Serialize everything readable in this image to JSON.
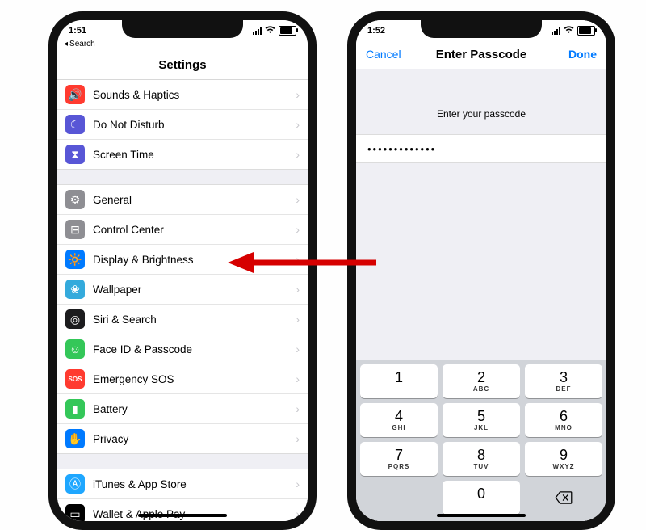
{
  "leftPhone": {
    "statusbar": {
      "time": "1:51",
      "locationArrow": "↗",
      "backLabel": "Search"
    },
    "navbar": {
      "title": "Settings"
    },
    "groups": [
      {
        "rows": [
          {
            "id": "sounds",
            "label": "Sounds & Haptics",
            "iconBg": "#ff3b30",
            "glyph": "🔊"
          },
          {
            "id": "dnd",
            "label": "Do Not Disturb",
            "iconBg": "#5856d6",
            "glyph": "☾"
          },
          {
            "id": "screentime",
            "label": "Screen Time",
            "iconBg": "#5856d6",
            "glyph": "⧗"
          }
        ]
      },
      {
        "rows": [
          {
            "id": "general",
            "label": "General",
            "iconBg": "#8e8e93",
            "glyph": "⚙"
          },
          {
            "id": "controlcenter",
            "label": "Control Center",
            "iconBg": "#8e8e93",
            "glyph": "⊟"
          },
          {
            "id": "display",
            "label": "Display & Brightness",
            "iconBg": "#007aff",
            "glyph": "🔆"
          },
          {
            "id": "wallpaper",
            "label": "Wallpaper",
            "iconBg": "#34aadc",
            "glyph": "❀"
          },
          {
            "id": "siri",
            "label": "Siri & Search",
            "iconBg": "#1c1c1e",
            "glyph": "◎"
          },
          {
            "id": "faceid",
            "label": "Face ID & Passcode",
            "iconBg": "#34c759",
            "glyph": "☺"
          },
          {
            "id": "sos",
            "label": "Emergency SOS",
            "iconBg": "#ff3b30",
            "glyph": "SOS",
            "small": true
          },
          {
            "id": "battery",
            "label": "Battery",
            "iconBg": "#34c759",
            "glyph": "▮"
          },
          {
            "id": "privacy",
            "label": "Privacy",
            "iconBg": "#007aff",
            "glyph": "✋"
          }
        ]
      },
      {
        "rows": [
          {
            "id": "itunes",
            "label": "iTunes & App Store",
            "iconBg": "#1fa7ff",
            "glyph": "Ⓐ"
          },
          {
            "id": "wallet",
            "label": "Wallet & Apple Pay",
            "iconBg": "#000000",
            "glyph": "▭"
          }
        ]
      }
    ]
  },
  "rightPhone": {
    "statusbar": {
      "time": "1:52",
      "locationArrow": "↗"
    },
    "navbar": {
      "cancel": "Cancel",
      "title": "Enter Passcode",
      "done": "Done"
    },
    "prompt": "Enter your passcode",
    "passcodeMasked": "•••••••••••••",
    "keypad": [
      {
        "num": "1",
        "letters": ""
      },
      {
        "num": "2",
        "letters": "ABC"
      },
      {
        "num": "3",
        "letters": "DEF"
      },
      {
        "num": "4",
        "letters": "GHI"
      },
      {
        "num": "5",
        "letters": "JKL"
      },
      {
        "num": "6",
        "letters": "MNO"
      },
      {
        "num": "7",
        "letters": "PQRS"
      },
      {
        "num": "8",
        "letters": "TUV"
      },
      {
        "num": "9",
        "letters": "WXYZ"
      },
      {
        "blank": true
      },
      {
        "num": "0",
        "letters": ""
      },
      {
        "del": true
      }
    ]
  },
  "arrowColor": "#d60000"
}
